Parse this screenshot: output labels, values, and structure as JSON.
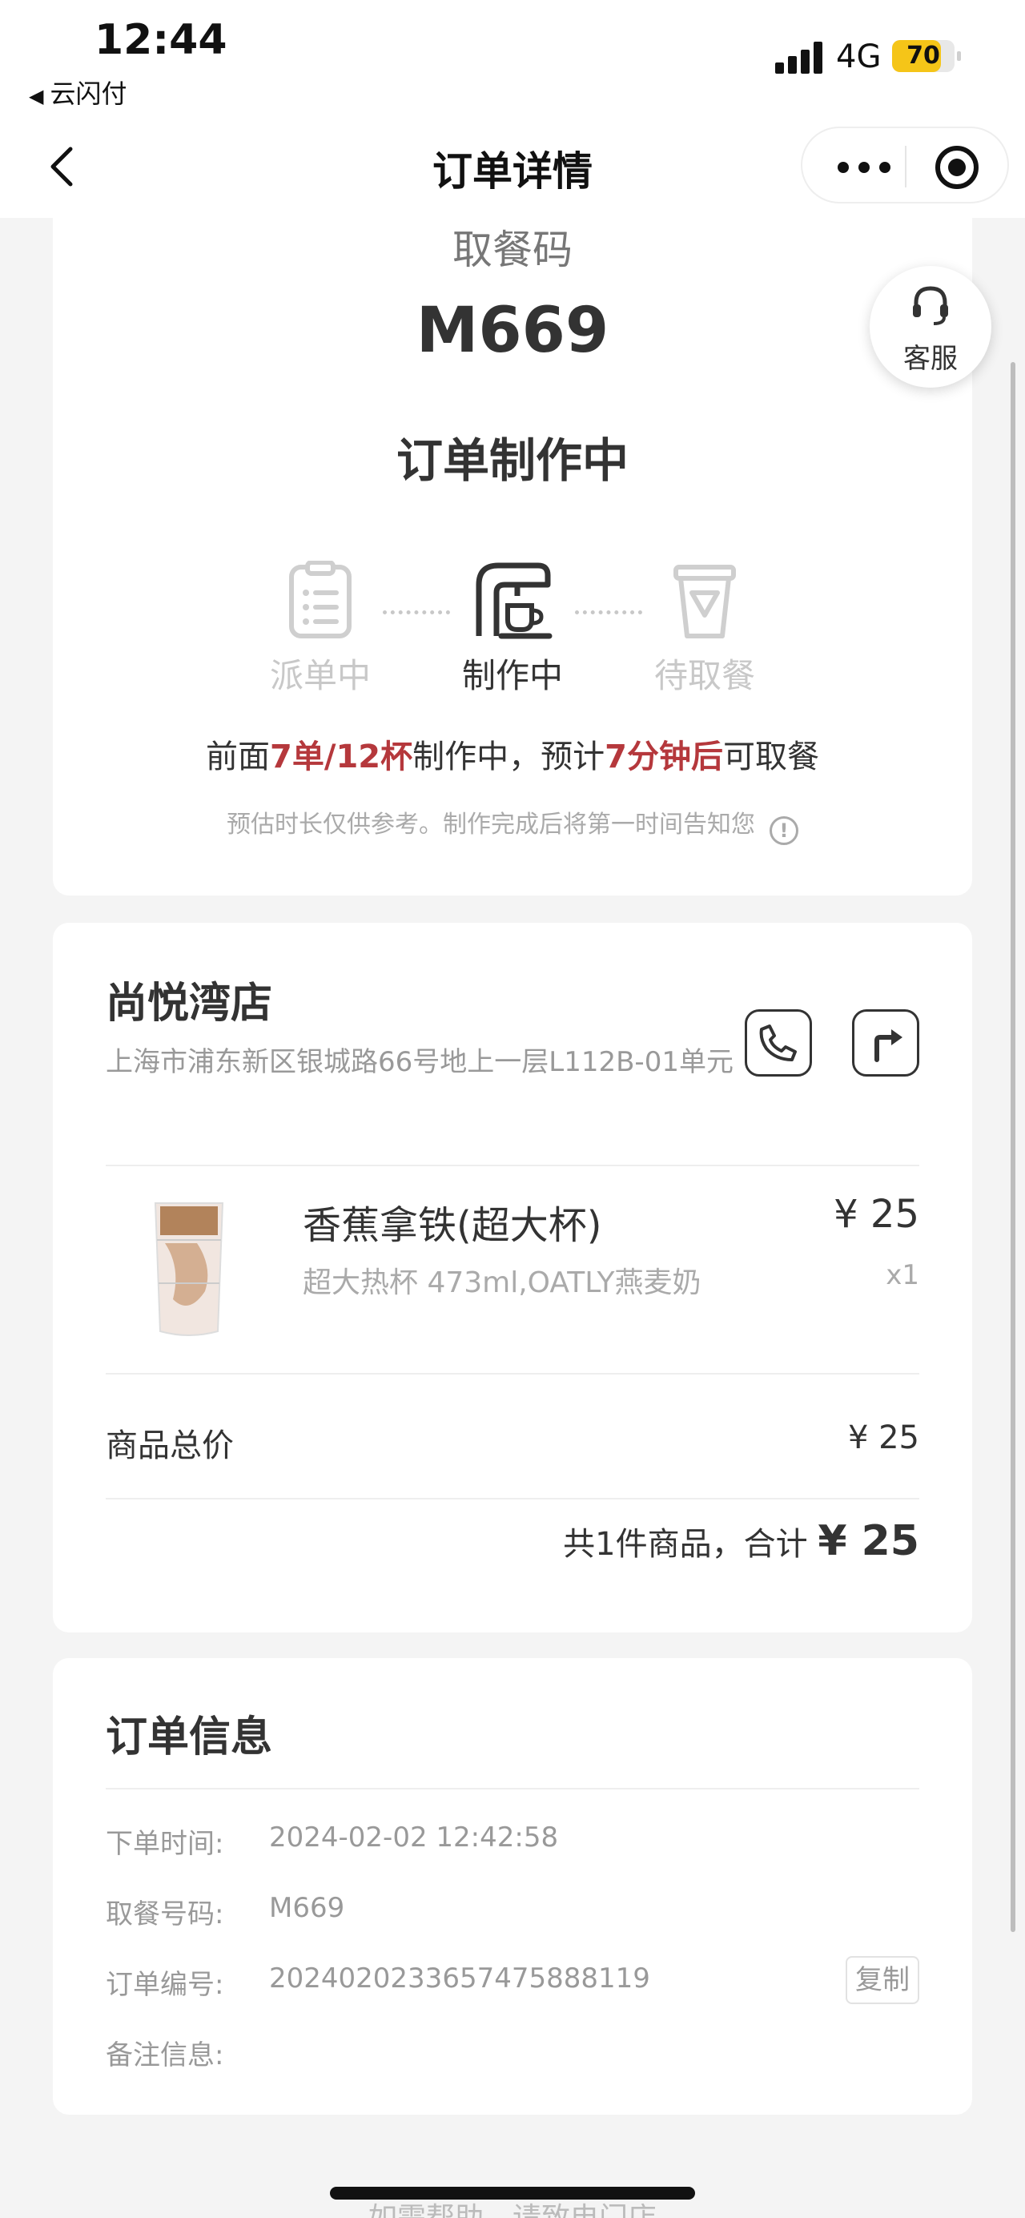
{
  "status_bar": {
    "time": "12:44",
    "back_app": "云闪付",
    "network": "4G",
    "battery": "70"
  },
  "nav": {
    "title": "订单详情"
  },
  "pickup": {
    "label": "取餐码",
    "code": "M669",
    "status": "订单制作中",
    "steps": [
      {
        "label": "派单中",
        "icon": "clipboard-list-icon"
      },
      {
        "label": "制作中",
        "icon": "coffee-machine-icon"
      },
      {
        "label": "待取餐",
        "icon": "takeaway-cup-icon"
      }
    ],
    "progress": {
      "p1": "前面",
      "p2": "7单/12杯",
      "p3": "制作中，预计",
      "p4": "7分钟后",
      "p5": "可取餐"
    },
    "disclaimer": "预估时长仅供参考。制作完成后将第一时间告知您",
    "info_icon": "!"
  },
  "customer_service": {
    "label": "客服"
  },
  "store": {
    "name": "尚悦湾店",
    "address": "上海市浦东新区银城路66号地上一层L112B-01单元",
    "call_icon": "phone-icon",
    "nav_icon": "directions-icon"
  },
  "product": {
    "name": "香蕉拿铁(超大杯)",
    "spec": "超大热杯 473ml,OATLY燕麦奶",
    "price": "¥ 25",
    "qty": "x1"
  },
  "summary": {
    "subtotal_label": "商品总价",
    "subtotal_value": "¥ 25",
    "total_text": "共1件商品，合计 ",
    "total_value": "¥ 25"
  },
  "order_info": {
    "title": "订单信息",
    "rows": [
      {
        "key": "下单时间:",
        "value": "2024-02-02 12:42:58"
      },
      {
        "key": "取餐号码:",
        "value": "M669"
      },
      {
        "key": "订单编号:",
        "value": "20240202336574758881​19"
      },
      {
        "key": "备注信息:",
        "value": ""
      }
    ],
    "copy_label": "复制"
  },
  "footer": {
    "hint": "如需帮助，请致电门店"
  },
  "colors": {
    "accent_red": "#b5383c",
    "muted": "#999999"
  }
}
